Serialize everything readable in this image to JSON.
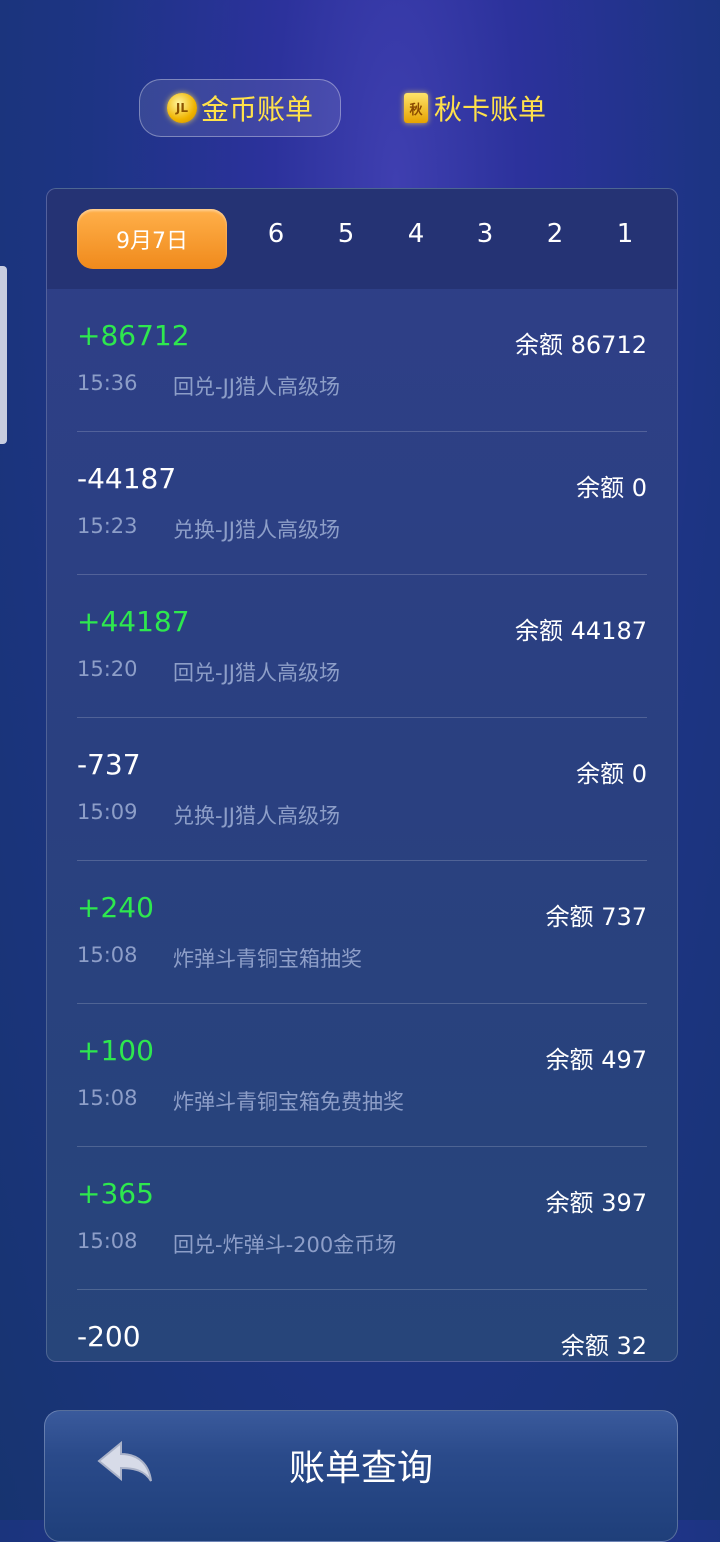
{
  "top_tabs": {
    "coin": {
      "label": "金币账单",
      "icon_text": "JL"
    },
    "card": {
      "label": "秋卡账单",
      "icon_text": "秋"
    }
  },
  "date_bar": {
    "selected": "9月7日",
    "days": [
      "6",
      "5",
      "4",
      "3",
      "2",
      "1"
    ]
  },
  "transactions": [
    {
      "amount": "+86712",
      "balance": "余额 86712",
      "time": "15:36",
      "desc": "回兑-JJ猎人高级场"
    },
    {
      "amount": "-44187",
      "balance": "余额 0",
      "time": "15:23",
      "desc": "兑换-JJ猎人高级场"
    },
    {
      "amount": "+44187",
      "balance": "余额 44187",
      "time": "15:20",
      "desc": "回兑-JJ猎人高级场"
    },
    {
      "amount": "-737",
      "balance": "余额 0",
      "time": "15:09",
      "desc": "兑换-JJ猎人高级场"
    },
    {
      "amount": "+240",
      "balance": "余额 737",
      "time": "15:08",
      "desc": "炸弹斗青铜宝箱抽奖"
    },
    {
      "amount": "+100",
      "balance": "余额 497",
      "time": "15:08",
      "desc": "炸弹斗青铜宝箱免费抽奖"
    },
    {
      "amount": "+365",
      "balance": "余额 397",
      "time": "15:08",
      "desc": "回兑-炸弹斗-200金币场"
    },
    {
      "amount": "-200",
      "balance": "余额 32",
      "time": "",
      "desc": ""
    }
  ],
  "bottom_bar": {
    "title": "账单查询"
  },
  "colors": {
    "positive": "#2ee84e",
    "negative": "#ffffff",
    "accent": "#f08a1c",
    "tab_text": "#ffe14a"
  }
}
